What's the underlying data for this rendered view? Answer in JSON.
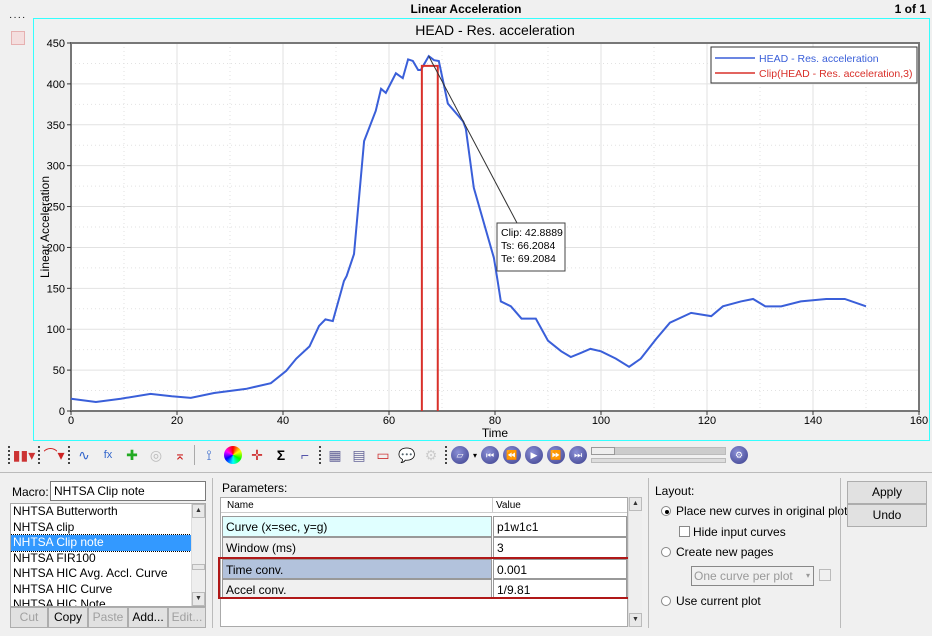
{
  "window": {
    "title": "Linear Acceleration",
    "page_indicator": "1 of 1"
  },
  "chart_data": {
    "type": "line",
    "title": "HEAD - Res. acceleration",
    "xlabel": "Time",
    "ylabel": "Linear Acceleration",
    "xlim": [
      0,
      160
    ],
    "ylim": [
      0,
      450
    ],
    "xticks": [
      "0",
      "20",
      "40",
      "60",
      "80",
      "100",
      "120",
      "140",
      "160"
    ],
    "yticks": [
      "0",
      "50",
      "100",
      "150",
      "200",
      "250",
      "300",
      "350",
      "400",
      "450"
    ],
    "grid": true,
    "legend_position": "top-right",
    "series": [
      {
        "name": "HEAD - Res. acceleration",
        "color": "#3a5fd9",
        "x": [
          0,
          4.7,
          9.4,
          15,
          19,
          22.6,
          27,
          33,
          37.7,
          40.6,
          42.5,
          45,
          46.8,
          48,
          49.4,
          51,
          51.5,
          52,
          53.4,
          55.3,
          57.5,
          58.5,
          59.4,
          61.3,
          62.6,
          63.6,
          64.5,
          65.5,
          66,
          67.5,
          68.5,
          69.4,
          71.1,
          74,
          74.5,
          76,
          79.8,
          80.5,
          81.1,
          83,
          85,
          87.7,
          90,
          92.5,
          94.3,
          96.2,
          98,
          100,
          102.8,
          105.3,
          107.5,
          110.4,
          113,
          117,
          120.8,
          123,
          126.4,
          128.7,
          131,
          134,
          137.7,
          142.5,
          146,
          150
        ],
        "y": [
          15,
          11,
          15,
          21,
          18,
          16,
          22,
          27,
          34,
          49,
          64,
          79,
          104,
          112,
          110,
          147,
          159,
          165,
          192,
          330,
          367,
          394,
          389,
          413,
          407,
          430,
          428,
          417,
          417,
          434,
          429,
          428,
          376,
          354,
          345,
          273,
          187,
          159,
          134,
          128,
          113,
          113,
          86,
          73,
          66,
          71,
          76,
          73,
          64,
          54,
          64,
          88,
          108,
          120,
          116,
          128,
          134,
          137,
          128,
          128,
          134,
          137,
          137,
          128
        ]
      },
      {
        "name": "Clip(HEAD - Res. acceleration,3)",
        "color": "#d9302a",
        "x": [
          66.2,
          66.2,
          69.2,
          69.2
        ],
        "y": [
          0,
          422,
          422,
          0
        ]
      }
    ],
    "annotation": {
      "lines": [
        "Clip: 42.8889",
        "Ts: 66.2084",
        "Te: 69.2084"
      ],
      "anchor_x": 67.5,
      "anchor_y": 434
    }
  },
  "toolbar": {
    "icons": [
      "histogram-icon",
      "curve-type-icon",
      "table-curve-icon",
      "math-curve-icon",
      "add-curve-icon",
      "filter-icon",
      "flip-curve-icon",
      "trim-icon",
      "color-wheel-icon",
      "crosshair-icon",
      "sigma-icon",
      "step-curve-icon",
      "grid-icon",
      "legend-icon",
      "page-icon",
      "note-icon",
      "settings-icon"
    ],
    "media": [
      "first-icon",
      "rewind-icon",
      "play-icon",
      "fast-forward-icon",
      "last-icon"
    ]
  },
  "macro": {
    "label": "Macro:",
    "value": "NHTSA Clip note",
    "items": [
      "NHTSA Butterworth",
      "NHTSA clip",
      "NHTSA Clip note",
      "NHTSA FIR100",
      "NHTSA HIC Avg. Accl. Curve",
      "NHTSA HIC Curve",
      "NHTSA HIC Note"
    ],
    "selected_index": 2,
    "buttons": {
      "cut": "Cut",
      "copy": "Copy",
      "paste": "Paste",
      "add": "Add...",
      "edit": "Edit..."
    }
  },
  "parameters": {
    "label": "Parameters:",
    "headers": [
      "Name",
      "Value"
    ],
    "rows": [
      {
        "name": "Curve (x=sec, y=g)",
        "value": "p1w1c1"
      },
      {
        "name": "Window (ms)",
        "value": "3"
      },
      {
        "name": "Time conv.",
        "value": "0.001"
      },
      {
        "name": "Accel conv.",
        "value": "1/9.81"
      }
    ]
  },
  "layout": {
    "label": "Layout:",
    "place_new": "Place new curves in original plot",
    "hide_input": "Hide input curves",
    "create_pages": "Create new pages",
    "per_plot": "One curve per plot",
    "use_current": "Use current plot",
    "selected": "place_new"
  },
  "actions": {
    "apply": "Apply",
    "undo": "Undo"
  }
}
